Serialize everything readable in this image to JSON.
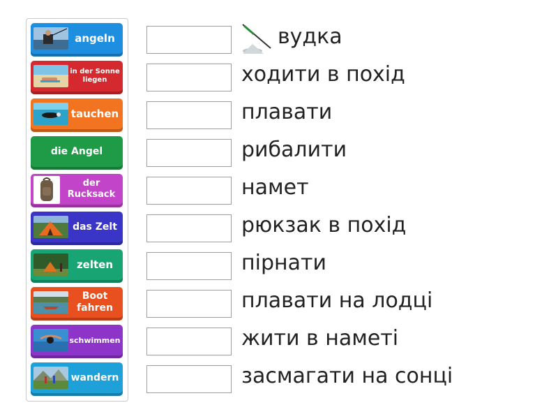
{
  "colors": {
    "blue": "#1e8fe0",
    "red": "#d3292f",
    "orange": "#f27420",
    "green": "#1f9b48",
    "magenta": "#c244c8",
    "indigo": "#3a35c6",
    "teal": "#18a473",
    "deeporange": "#e8501f",
    "purple": "#8d35c8",
    "lightblue": "#1ea0d8"
  },
  "tiles": [
    {
      "label": "angeln",
      "color": "blue",
      "icon": "fisherman-photo"
    },
    {
      "label": "in der Sonne liegen",
      "color": "red",
      "icon": "beach-photo"
    },
    {
      "label": "tauchen",
      "color": "orange",
      "icon": "diver-photo"
    },
    {
      "label": "die Angel",
      "color": "green",
      "icon": ""
    },
    {
      "label": "der Rucksack",
      "color": "magenta",
      "icon": "backpack-photo"
    },
    {
      "label": "das Zelt",
      "color": "indigo",
      "icon": "tent-photo"
    },
    {
      "label": "zelten",
      "color": "teal",
      "icon": "camping-photo"
    },
    {
      "label": "Boot fahren",
      "color": "deeporange",
      "icon": "boat-photo"
    },
    {
      "label": "schwimmen",
      "color": "purple",
      "icon": "swimmer-photo"
    },
    {
      "label": "wandern",
      "color": "lightblue",
      "icon": "hikers-photo"
    }
  ],
  "targets": [
    {
      "text": "вудка",
      "icon": "fishing-rod-icon"
    },
    {
      "text": "ходити в похід"
    },
    {
      "text": "плавати"
    },
    {
      "text": "рибалити"
    },
    {
      "text": "намет"
    },
    {
      "text": "рюкзак в похід"
    },
    {
      "text": "пірнати"
    },
    {
      "text": "плавати на лодці"
    },
    {
      "text": "жити в наметі"
    },
    {
      "text": "засмагати на сонці"
    }
  ]
}
